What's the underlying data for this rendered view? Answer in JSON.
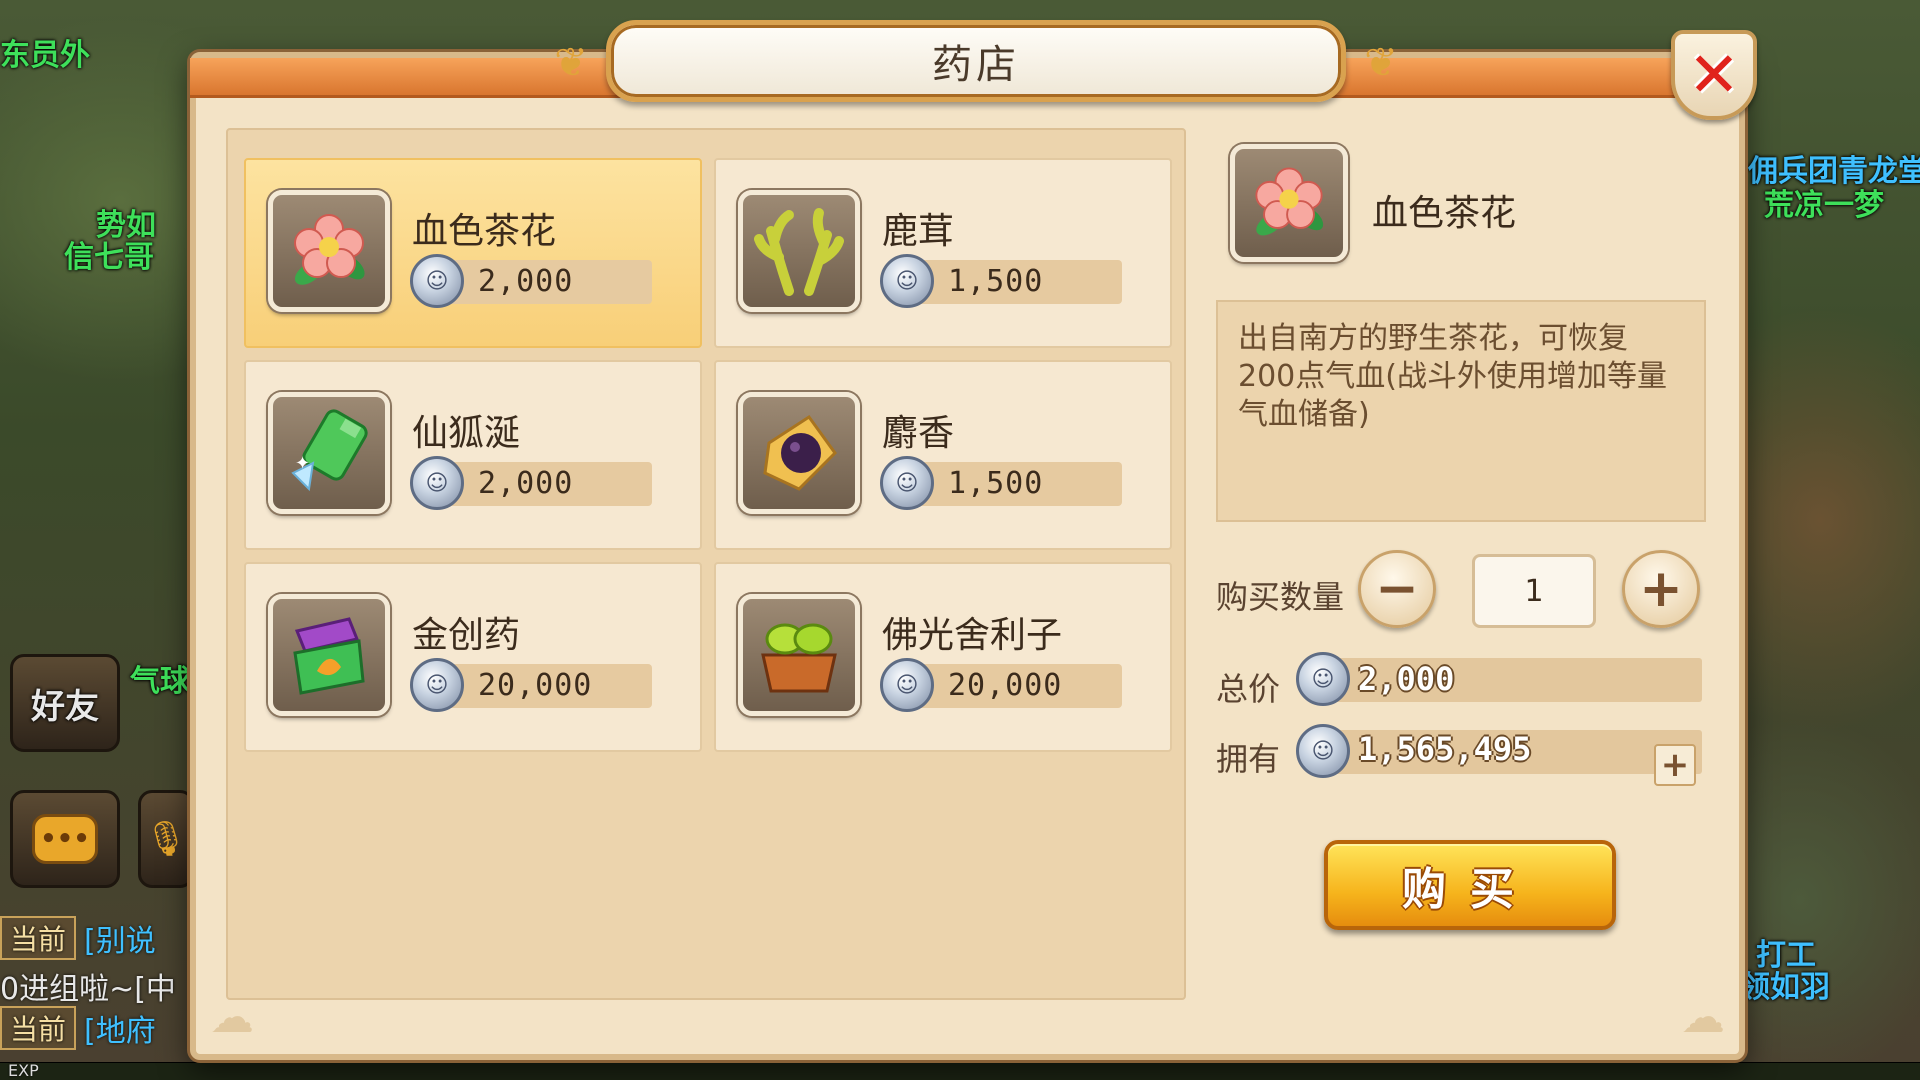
{
  "colors": {
    "title_band": "#e6873d",
    "dialog_bg": "#f3e3c6",
    "panel_bg": "#ecd4ad",
    "selected_card": "#fbd98c",
    "close_red": "#e0231c",
    "buy_button": "#f6b41c",
    "npc_green": "#3ee05a",
    "npc_blue": "#3fc0ff"
  },
  "scene": {
    "npc_name_1": "东员外",
    "npc_name_2": "势如",
    "npc_name_3": "信七哥",
    "npc_name_4": "佣兵团青龙堂",
    "npc_name_5": "荒凉一梦",
    "npc_name_6": "打工",
    "npc_name_7": "领如羽",
    "npc_name_8": "气球",
    "friend_label": "好友",
    "chat_lines": [
      {
        "tag": "当前",
        "text": "[别说"
      },
      {
        "tag": "",
        "text": "0进组啦~[中"
      },
      {
        "tag": "当前",
        "text": "[地府"
      }
    ],
    "exp_label": "EXP"
  },
  "dialog": {
    "title": "药店",
    "close_icon": "close-x-icon"
  },
  "items": [
    {
      "name": "血色茶花",
      "price": "2,000",
      "icon": "camellia-flower-icon",
      "selected": true
    },
    {
      "name": "鹿茸",
      "price": "1,500",
      "icon": "antler-icon",
      "selected": false
    },
    {
      "name": "仙狐涎",
      "price": "2,000",
      "icon": "jade-bottle-icon",
      "selected": false
    },
    {
      "name": "麝香",
      "price": "1,500",
      "icon": "musk-icon",
      "selected": false
    },
    {
      "name": "金创药",
      "price": "20,000",
      "icon": "medicine-box-icon",
      "selected": false
    },
    {
      "name": "佛光舍利子",
      "price": "20,000",
      "icon": "relic-basket-icon",
      "selected": false
    }
  ],
  "detail": {
    "name": "血色茶花",
    "icon": "camellia-flower-icon",
    "description": "出自南方的野生茶花，可恢复200点气血(战斗外使用增加等量气血储备)",
    "qty_label": "购买数量",
    "qty_value": "1",
    "minus_label": "−",
    "plus_label": "+",
    "total_label": "总价",
    "total_value": "2,000",
    "owned_label": "拥有",
    "owned_value": "1,565,495",
    "add_money_label": "+",
    "buy_label": "购买"
  }
}
